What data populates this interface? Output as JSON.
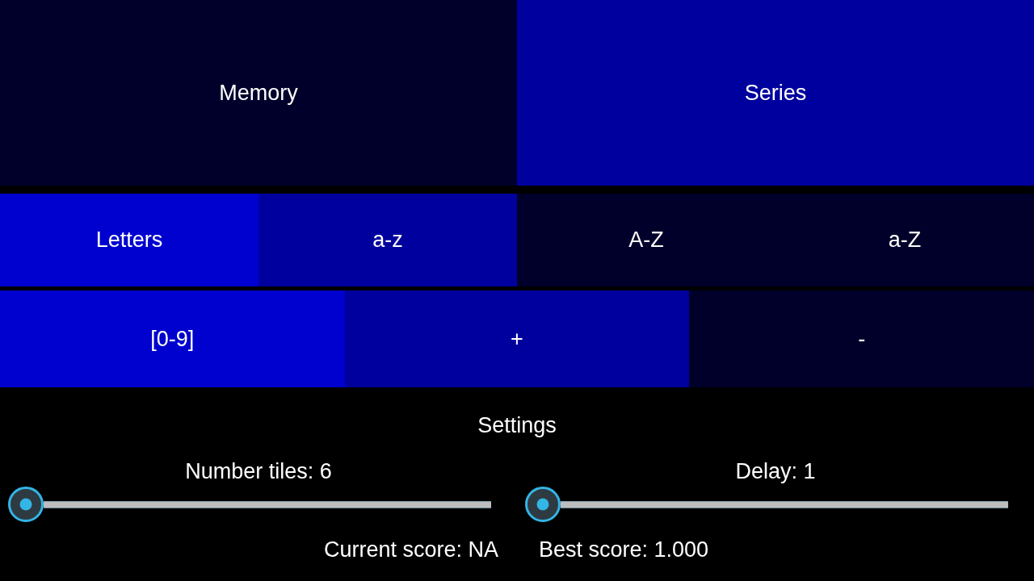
{
  "modes": [
    {
      "label": "Memory",
      "selected": false
    },
    {
      "label": "Series",
      "selected": true
    }
  ],
  "letters": [
    {
      "label": "Letters",
      "kind": "category",
      "selected": true
    },
    {
      "label": "a-z",
      "kind": "option",
      "selected": true
    },
    {
      "label": "A-Z",
      "kind": "option",
      "selected": false
    },
    {
      "label": "a-Z",
      "kind": "option",
      "selected": false
    }
  ],
  "numbers": [
    {
      "label": "[0-9]",
      "kind": "category",
      "selected": true
    },
    {
      "label": "+",
      "kind": "option",
      "selected": true
    },
    {
      "label": "-",
      "kind": "option",
      "selected": false
    }
  ],
  "settings": {
    "title": "Settings",
    "sliders": [
      {
        "label": "Number tiles: 6",
        "level": 0
      },
      {
        "label": "Delay: 1",
        "level": 0
      }
    ],
    "current_score": "Current score: NA",
    "best_score": "Best score: 1.000"
  }
}
